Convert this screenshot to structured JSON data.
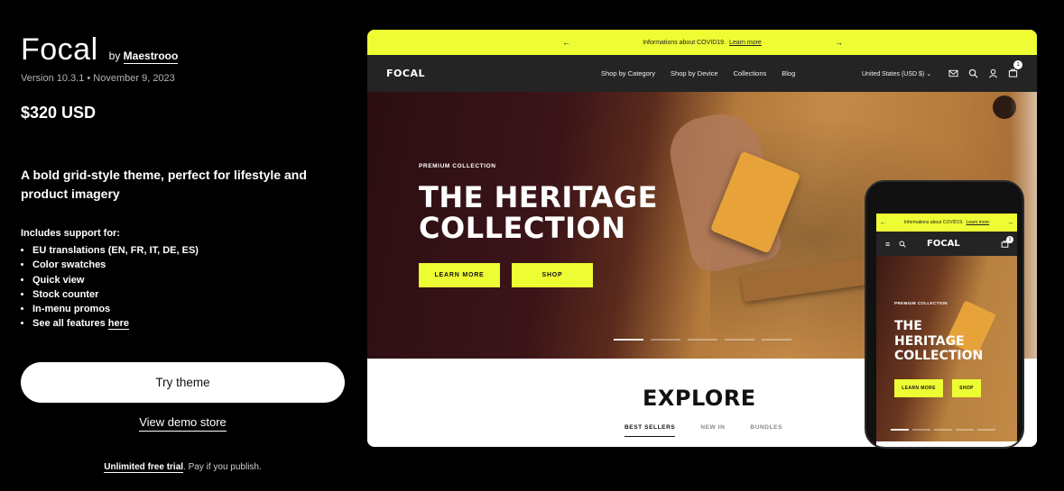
{
  "theme": {
    "name": "Focal",
    "by_prefix": "by",
    "author": "Maestrooo",
    "version_line": "Version 10.3.1 • November 9, 2023",
    "price": "$320 USD",
    "tagline": "A bold grid-style theme, perfect for lifestyle and product imagery",
    "features_heading": "Includes support for:",
    "features": [
      "EU translations (EN, FR, IT, DE, ES)",
      "Color swatches",
      "Quick view",
      "Stock counter",
      "In-menu promos"
    ],
    "see_all_prefix": "See all features ",
    "see_all_link": "here",
    "try_button": "Try theme",
    "demo_link": "View demo store",
    "trial_bold": "Unlimited free trial",
    "trial_rest": ". Pay if you publish."
  },
  "preview": {
    "announcement_text": "Informations about COVID19.",
    "announcement_link": "Learn more",
    "logo": "FOCAL",
    "menu": [
      "Shop by Category",
      "Shop by Device",
      "Collections",
      "Blog"
    ],
    "locale": "United States (USD $) ⌄",
    "cart_count": "1",
    "hero_eyebrow": "PREMIUM COLLECTION",
    "hero_title_line1": "THE HERITAGE",
    "hero_title_line2": "COLLECTION",
    "hero_btn_primary": "LEARN MORE",
    "hero_btn_secondary": "SHOP",
    "explore_title": "EXPLORE",
    "tabs": [
      "BEST SELLERS",
      "NEW IN",
      "BUNDLES"
    ]
  },
  "mobile": {
    "announcement_text": "Informations about COVID19.",
    "announcement_link": "Learn more",
    "logo": "FOCAL",
    "cart_count": "1",
    "hero_eyebrow": "PREMIUM COLLECTION",
    "hero_title_line1": "THE",
    "hero_title_line2": "HERITAGE",
    "hero_title_line3": "COLLECTION",
    "hero_btn_primary": "LEARN MORE",
    "hero_btn_secondary": "SHOP"
  },
  "colors": {
    "accent": "#eefc34",
    "background": "#000000",
    "nav_bar": "#242424"
  },
  "icons": [
    "arrow-left-icon",
    "arrow-right-icon",
    "mail-icon",
    "search-icon",
    "account-icon",
    "cart-icon",
    "hamburger-icon"
  ]
}
